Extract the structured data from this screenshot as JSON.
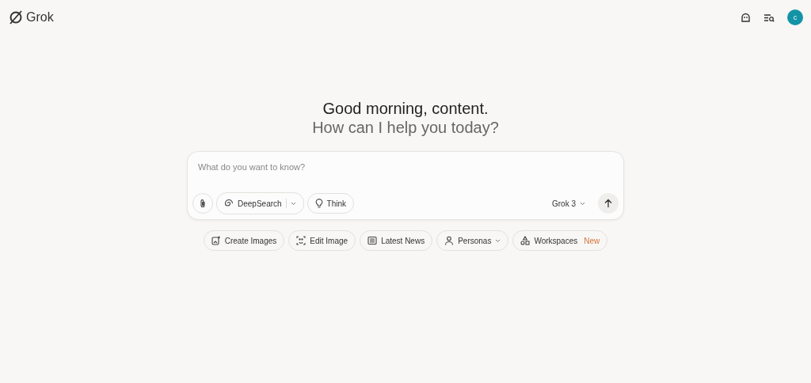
{
  "brand": {
    "name": "Grok"
  },
  "greeting": {
    "title": "Good morning, content.",
    "subtitle": "How can I help you today?"
  },
  "avatar": {
    "initial": "c"
  },
  "composer": {
    "placeholder": "What do you want to know?",
    "model": "Grok 3"
  },
  "tools": [
    {
      "kind": "deepsearch",
      "label": "DeepSearch"
    },
    {
      "kind": "think",
      "label": "Think"
    }
  ],
  "actions": [
    {
      "kind": "create",
      "label": "Create Images"
    },
    {
      "kind": "edit",
      "label": "Edit Image"
    },
    {
      "kind": "news",
      "label": "Latest News"
    },
    {
      "kind": "personas",
      "label": "Personas",
      "dropdown": true
    },
    {
      "kind": "workspaces",
      "label": "Workspaces",
      "badge": "New"
    }
  ]
}
